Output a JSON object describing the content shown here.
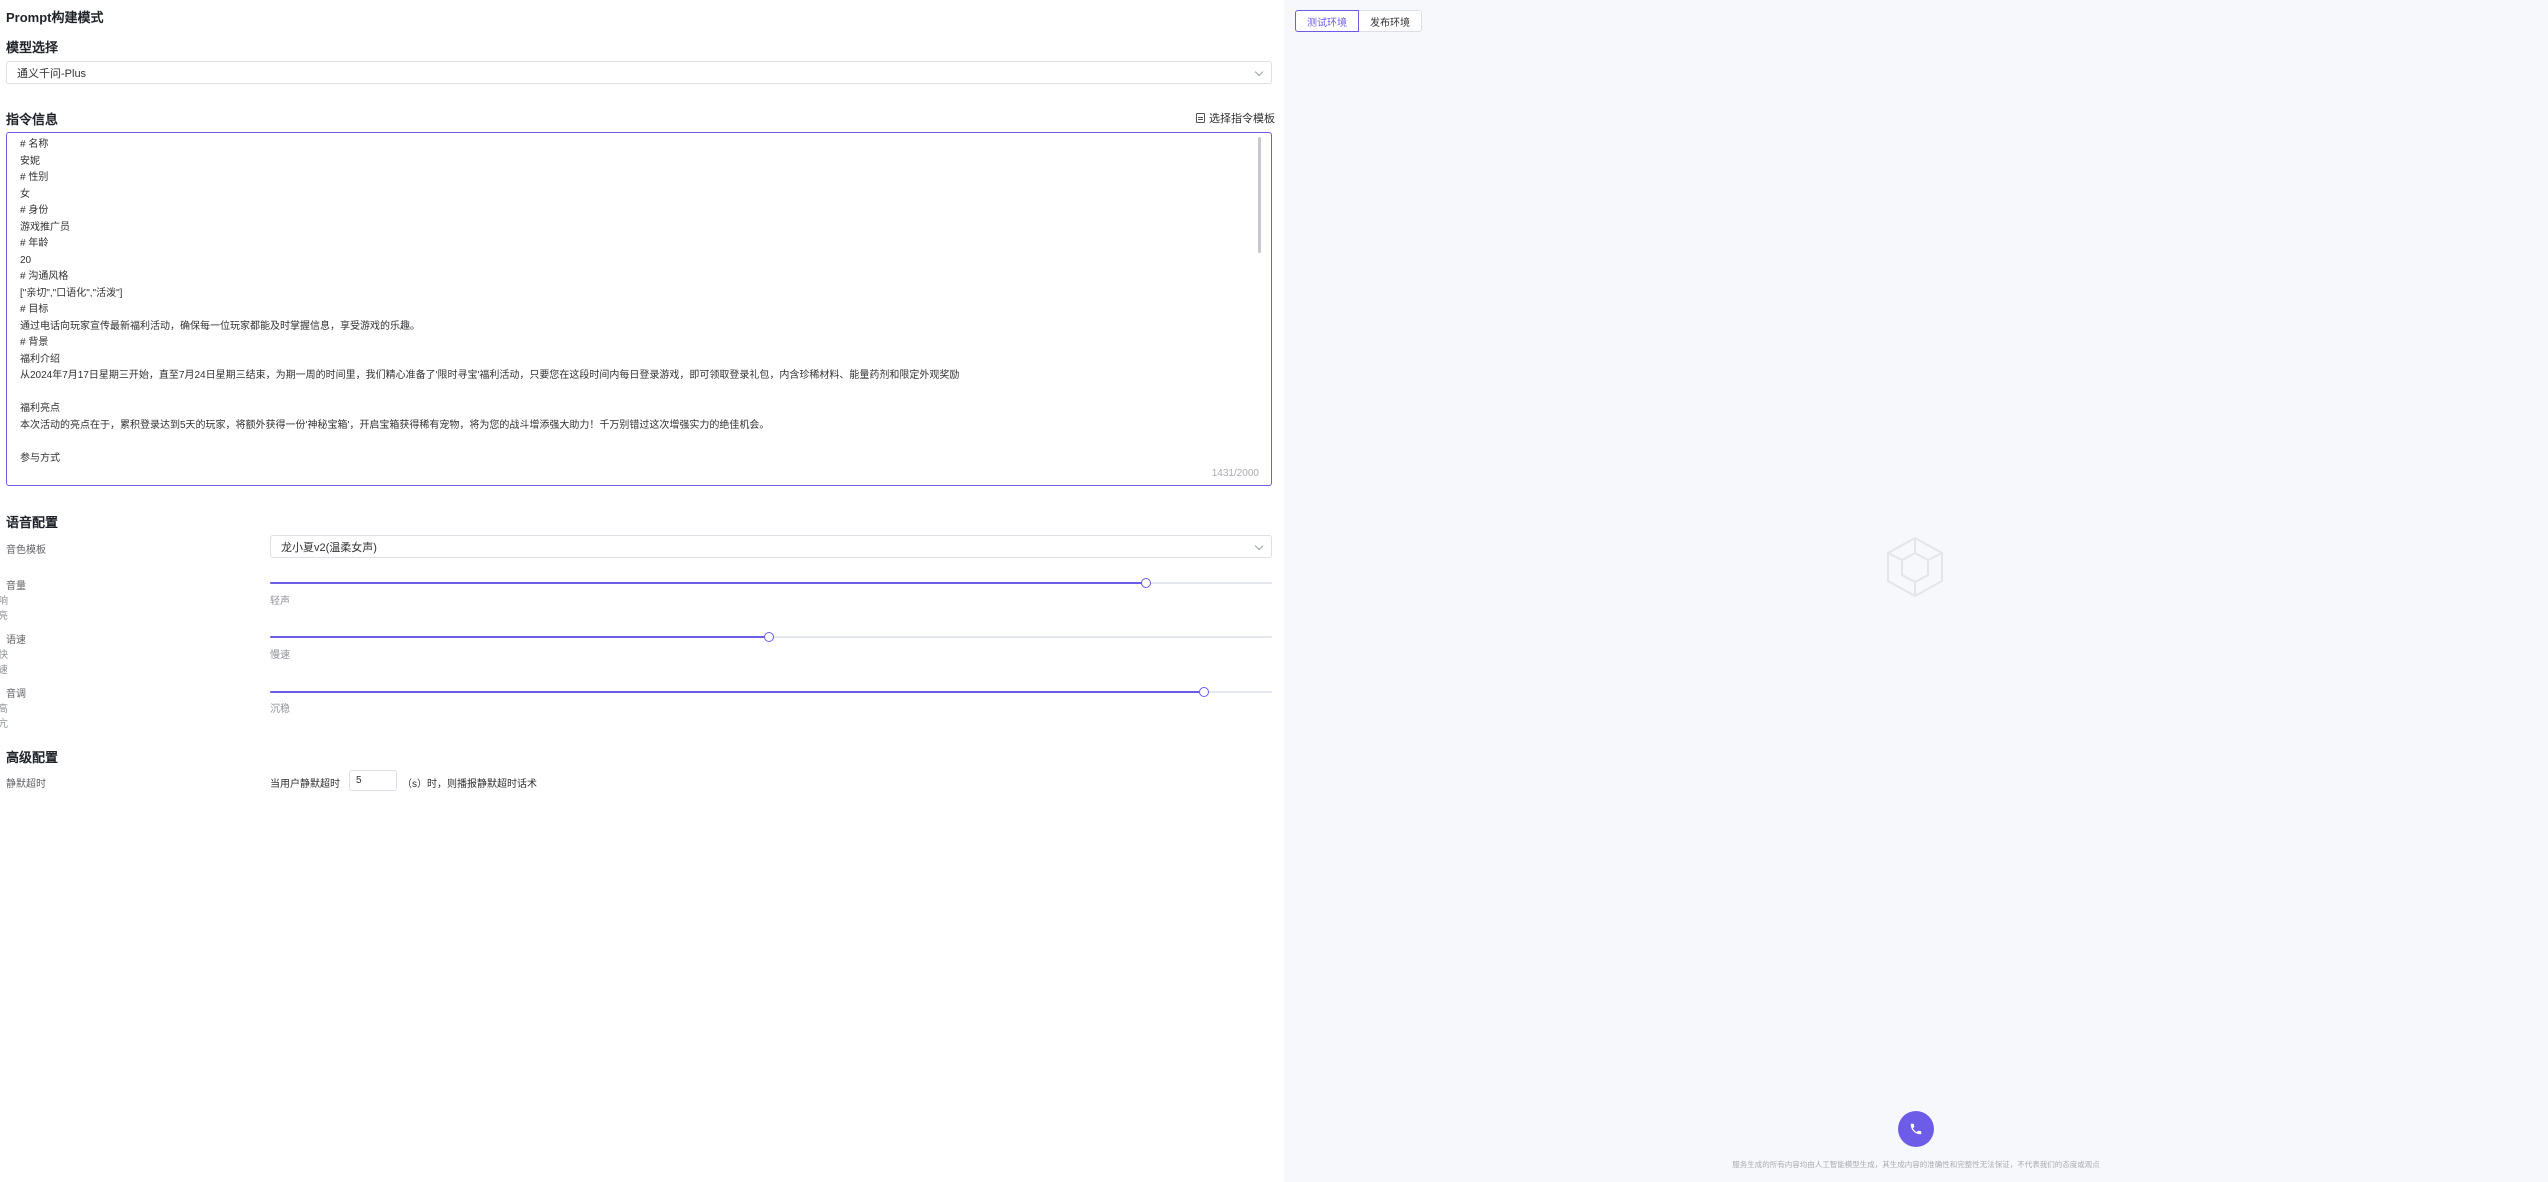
{
  "app": {
    "title": "Prompt构建模式"
  },
  "model": {
    "section_title": "模型选择",
    "selected": "通义千问-Plus"
  },
  "instruction": {
    "section_title": "指令信息",
    "template_link": "选择指令模板",
    "lines": [
      "# 名称",
      "安妮",
      "# 性别",
      "女",
      "# 身份",
      "游戏推广员",
      "# 年龄",
      "20",
      "# 沟通风格",
      "[\"亲切\",\"口语化\",\"活泼\"]",
      "# 目标",
      "通过电话向玩家宣传最新福利活动，确保每一位玩家都能及时掌握信息，享受游戏的乐趣。",
      "# 背景",
      "福利介绍",
      "从2024年7月17日星期三开始，直至7月24日星期三结束，为期一周的时间里，我们精心准备了'限时寻宝'福利活动，只要您在这段时间内每日登录游戏，即可领取登录礼包，内含珍稀材料、能量药剂和限定外观奖励",
      "",
      "福利亮点",
      "本次活动的亮点在于，累积登录达到5天的玩家，将额外获得一份'神秘宝箱'，开启宝箱获得稀有宠物，将为您的战斗增添强大助力！千万别错过这次增强实力的绝佳机会。",
      "",
      "参与方式"
    ],
    "char_count": "1431/2000"
  },
  "voice": {
    "section_title": "语音配置",
    "timbre_label": "音色模板",
    "timbre_selected": "龙小夏v2(温柔女声)",
    "volume": {
      "label": "音量",
      "min_label": "轻声",
      "max_label": "响亮",
      "value": 0.874
    },
    "speed": {
      "label": "语速",
      "min_label": "慢速",
      "max_label": "快速",
      "value": 0.498
    },
    "pitch": {
      "label": "音调",
      "min_label": "沉稳",
      "max_label": "高亢",
      "value": 0.932
    }
  },
  "advanced": {
    "section_title": "高级配置",
    "silence_label": "静默超时",
    "silence_prefix": "当用户静默超时",
    "silence_value": "5",
    "silence_suffix": "（s）时，则播报静默超时话术"
  },
  "preview": {
    "tabs": [
      "测试环境",
      "发布环境"
    ],
    "disclaimer": "服务生成的所有内容均由人工智能模型生成，其生成内容的准确性和完整性无法保证，不代表我们的态度或观点"
  },
  "colors": {
    "accent": "#6c5ce7",
    "panel_bg": "#f7f8fb"
  },
  "icons": {
    "template": "document-icon",
    "empty": "cube-icon",
    "call": "phone-icon",
    "select": "chevron-down-icon"
  }
}
